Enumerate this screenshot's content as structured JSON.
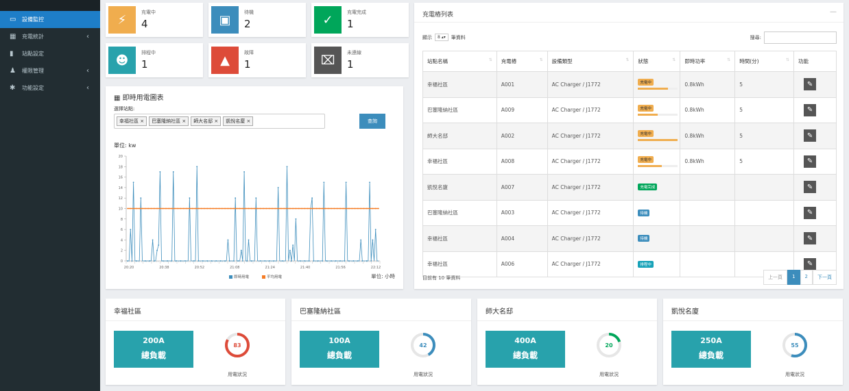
{
  "sidebar": {
    "items": [
      {
        "icon": "monitor-icon",
        "label": "設備監控",
        "active": true,
        "submenu": false
      },
      {
        "icon": "grid-icon",
        "label": "充電統計",
        "active": false,
        "submenu": true
      },
      {
        "icon": "station-icon",
        "label": "站點設定",
        "active": false,
        "submenu": false
      },
      {
        "icon": "users-icon",
        "label": "權限管理",
        "active": false,
        "submenu": true
      },
      {
        "icon": "gear-icon",
        "label": "功能設定",
        "active": false,
        "submenu": true
      }
    ]
  },
  "status_cards": [
    {
      "label": "充電中",
      "value": "4",
      "color": "#f0ad4e",
      "icon": "bolt-icon"
    },
    {
      "label": "待機",
      "value": "2",
      "color": "#3c8dbc",
      "icon": "charger-icon"
    },
    {
      "label": "充電完成",
      "value": "1",
      "color": "#00a65a",
      "icon": "check-circle-icon"
    },
    {
      "label": "排程中",
      "value": "1",
      "color": "#28a2ac",
      "icon": "user-clock-icon"
    },
    {
      "label": "故障",
      "value": "1",
      "color": "#dd4b39",
      "icon": "warning-icon"
    },
    {
      "label": "未連線",
      "value": "1",
      "color": "#555555",
      "icon": "plug-off-icon"
    }
  ],
  "chart_panel": {
    "title": "即時用電圖表",
    "select_label": "選擇站點:",
    "tags": [
      "幸福社區 ×",
      "巴塞隆納社區 ×",
      "師大名邸 ×",
      "凱悅名廈 ×"
    ],
    "query_button": "查詢",
    "unit_top": "單位: kw",
    "unit_bottom": "單位: 小時"
  },
  "chart_data": {
    "type": "line",
    "ylabel": "",
    "xlabel": "",
    "ylim": [
      0,
      20
    ],
    "yticks": [
      "0",
      "2",
      "4",
      "6",
      "8",
      "10",
      "12",
      "14",
      "16",
      "18",
      "20"
    ],
    "xticks": [
      "20:20",
      "20:38",
      "20:52",
      "21:08",
      "21:24",
      "21:40",
      "21:56",
      "22:12"
    ],
    "series": [
      {
        "name": "即時用電",
        "color": "#3c8dbc",
        "values": [
          0,
          0,
          6,
          0,
          15,
          0,
          0,
          0,
          0,
          12,
          0,
          0,
          0,
          0,
          0,
          0,
          0,
          4,
          0,
          0,
          2,
          3,
          17,
          0,
          0,
          0,
          0,
          0,
          0,
          0,
          0,
          17,
          0,
          0,
          0,
          0,
          0,
          0,
          0,
          0,
          0,
          0,
          12,
          0,
          0,
          0,
          0,
          18,
          0,
          0,
          0,
          0,
          0,
          0,
          0,
          0,
          0,
          0,
          0,
          0,
          0,
          0,
          0,
          0,
          0,
          0,
          0,
          0,
          4,
          0,
          0,
          0,
          0,
          12,
          0,
          0,
          0,
          2,
          0,
          17,
          0,
          0,
          4,
          0,
          0,
          0,
          0,
          12,
          0,
          0,
          0,
          0,
          0,
          0,
          0,
          0,
          0,
          0,
          0,
          0,
          0,
          0,
          14,
          0,
          0,
          0,
          0,
          0,
          18,
          0,
          2,
          0,
          3,
          0,
          8,
          0,
          0,
          0,
          0,
          0,
          0,
          0,
          0,
          0,
          10,
          12,
          0,
          0,
          0,
          0,
          0,
          0,
          0,
          15,
          0,
          0,
          0,
          0,
          0,
          0,
          0,
          0,
          0,
          0,
          0,
          0,
          0,
          0,
          15,
          0,
          0,
          0,
          0,
          0,
          0,
          0,
          0,
          0,
          4,
          0,
          0,
          0,
          0,
          0,
          15,
          0,
          4,
          0,
          6,
          0,
          0
        ]
      },
      {
        "name": "平均用電",
        "color": "#f57c24",
        "values": [
          10,
          10,
          10,
          10,
          10,
          10,
          10,
          10,
          10,
          10,
          10,
          10,
          10,
          10,
          10,
          10,
          10,
          10,
          10,
          10,
          10,
          10,
          10,
          10,
          10,
          10,
          10,
          10,
          10,
          10,
          10,
          10,
          10,
          10,
          10,
          10,
          10,
          10,
          10,
          10,
          10,
          10,
          10,
          10,
          10,
          10,
          10,
          10,
          10,
          10,
          10,
          10,
          10,
          10,
          10,
          10,
          10,
          10,
          10,
          10,
          10,
          10,
          10,
          10,
          10,
          10,
          10,
          10,
          10,
          10,
          10,
          10,
          10,
          10,
          10,
          10,
          10,
          10,
          10,
          10,
          10,
          10,
          10,
          10,
          10,
          10,
          10,
          10,
          10,
          10,
          10,
          10,
          10,
          10,
          10,
          10,
          10,
          10,
          10,
          10,
          10,
          10,
          10,
          10,
          10,
          10,
          10,
          10,
          10,
          10,
          10,
          10,
          10,
          10,
          10,
          10,
          10,
          10,
          10,
          10,
          10,
          10,
          10,
          10,
          10,
          10,
          10,
          10,
          10,
          10,
          10,
          10,
          10,
          10,
          10,
          10,
          10,
          10,
          10,
          10,
          10,
          10,
          10,
          10,
          10,
          10,
          10,
          10,
          10,
          10,
          10,
          10,
          10,
          10,
          10,
          10,
          10,
          10,
          10,
          10,
          10,
          10,
          10,
          10,
          10,
          10,
          10,
          10,
          10,
          10,
          10
        ]
      }
    ],
    "legend": [
      "即時用電",
      "平均用電"
    ]
  },
  "table_panel": {
    "title": "充電樁列表",
    "show_prefix": "顯示",
    "show_value": "8",
    "show_suffix": "筆資料",
    "search_label": "搜尋:",
    "headers": [
      "站點名稱",
      "充電樁",
      "設備類型",
      "狀態",
      "即時功率",
      "時間(分)",
      "功能"
    ],
    "rows": [
      {
        "site": "幸福社區",
        "pile": "A001",
        "type": "AC Charger / J1772",
        "status": "充電中",
        "status_class": "b-orange",
        "progress": 0.75,
        "power": "0.8kWh",
        "minutes": "5"
      },
      {
        "site": "巴塞隆納社區",
        "pile": "A009",
        "type": "AC Charger / J1772",
        "status": "充電中",
        "status_class": "b-orange",
        "progress": 0.5,
        "power": "0.8kWh",
        "minutes": "5"
      },
      {
        "site": "師大名邸",
        "pile": "A002",
        "type": "AC Charger / J1772",
        "status": "充電中",
        "status_class": "b-orange",
        "progress": 1.0,
        "power": "0.8kWh",
        "minutes": "5"
      },
      {
        "site": "幸福社區",
        "pile": "A008",
        "type": "AC Charger / J1772",
        "status": "充電中",
        "status_class": "b-orange",
        "progress": 0.6,
        "power": "0.8kWh",
        "minutes": "5"
      },
      {
        "site": "凱悅名廈",
        "pile": "A007",
        "type": "AC Charger / J1772",
        "status": "充電完成",
        "status_class": "b-green",
        "progress": null,
        "power": "",
        "minutes": ""
      },
      {
        "site": "巴塞隆納社區",
        "pile": "A003",
        "type": "AC Charger / J1772",
        "status": "待機",
        "status_class": "b-blue",
        "progress": null,
        "power": "",
        "minutes": ""
      },
      {
        "site": "幸福社區",
        "pile": "A004",
        "type": "AC Charger / J1772",
        "status": "待機",
        "status_class": "b-blue",
        "progress": null,
        "power": "",
        "minutes": ""
      },
      {
        "site": "幸福社區",
        "pile": "A006",
        "type": "AC Charger / J1772",
        "status": "排程中",
        "status_class": "b-teal",
        "progress": null,
        "power": "",
        "minutes": ""
      }
    ],
    "footer": "目前有 10 筆資料",
    "pager": {
      "prev": "上一頁",
      "pages": [
        "1",
        "2"
      ],
      "next": "下一頁"
    }
  },
  "sites": [
    {
      "name": "幸福社區",
      "amp": "200A",
      "cap_label": "總負載",
      "gauge": "83",
      "gauge_color": "#dd4b39",
      "gauge_caption": "用電狀況"
    },
    {
      "name": "巴塞隆納社區",
      "amp": "100A",
      "cap_label": "總負載",
      "gauge": "42",
      "gauge_color": "#3c8dbc",
      "gauge_caption": "用電狀況"
    },
    {
      "name": "師大名邸",
      "amp": "400A",
      "cap_label": "總負載",
      "gauge": "20",
      "gauge_color": "#00a65a",
      "gauge_caption": "用電狀況"
    },
    {
      "name": "凱悅名廈",
      "amp": "250A",
      "cap_label": "總負載",
      "gauge": "55",
      "gauge_color": "#3c8dbc",
      "gauge_caption": "用電狀況"
    }
  ]
}
